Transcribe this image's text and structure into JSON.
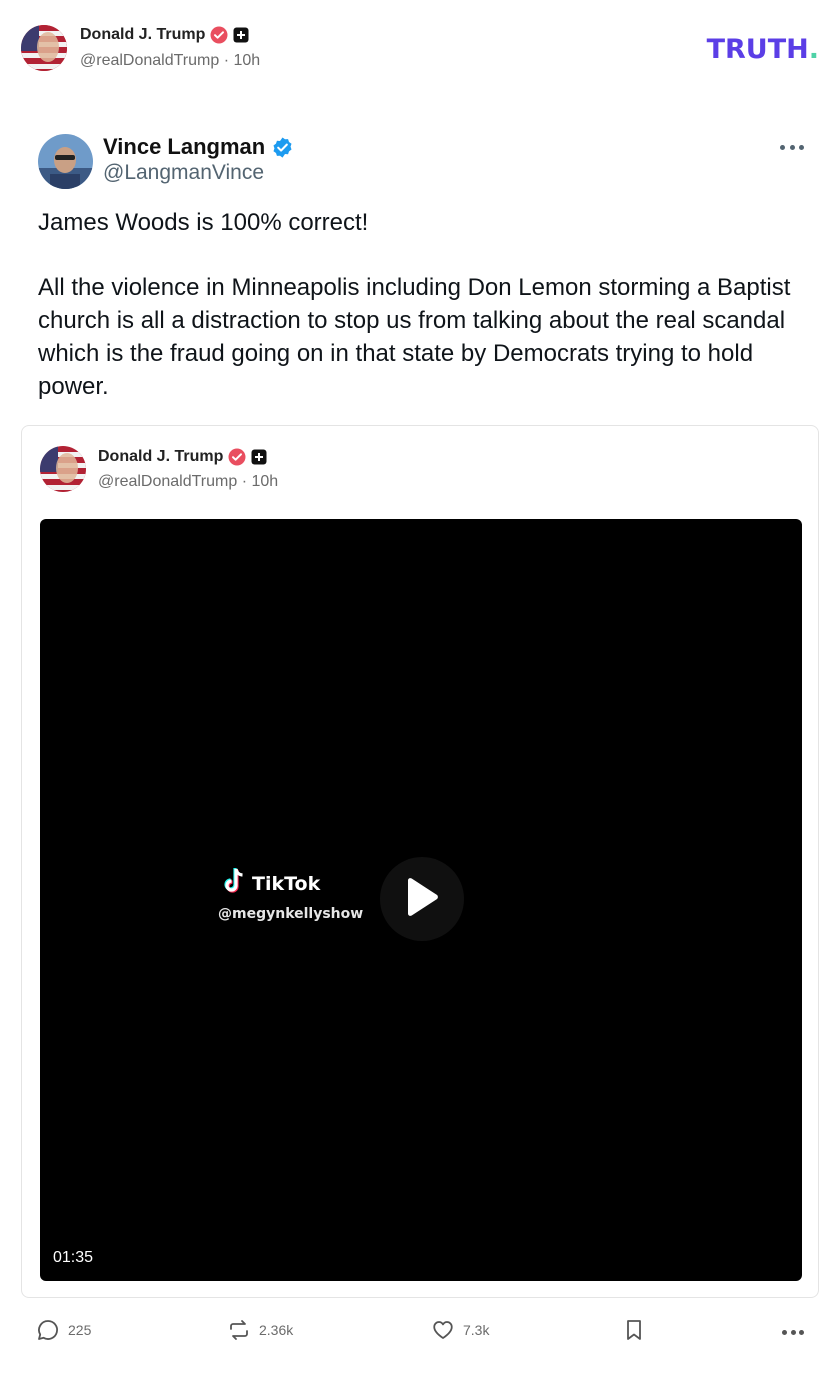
{
  "post": {
    "author_name": "Donald J. Trump",
    "author_handle": "@realDonaldTrump",
    "time": "10h",
    "brand": "TRUTH",
    "brand_dot": "."
  },
  "quoted": {
    "name": "Vince Langman",
    "handle": "@LangmanVince",
    "text_1": "James Woods is 100% correct!",
    "text_2": "All the violence in Minneapolis including Don Lemon storming a Baptist church is all a distraction to stop us from talking about the real scandal which is the fraud going on in that state by Democrats trying to hold power."
  },
  "embedded": {
    "author_name": "Donald J. Trump",
    "author_handle": "@realDonaldTrump",
    "time": "10h",
    "video": {
      "watermark": "TikTok",
      "watermark_user": "@megynkellyshow",
      "duration": "01:35"
    }
  },
  "actions": {
    "replies": "225",
    "retruths": "2.36k",
    "likes": "7.3k"
  },
  "icons": [
    "verified-icon",
    "plus-badge-icon",
    "blue-check-icon",
    "more-icon",
    "play-icon",
    "tiktok-icon",
    "reply-icon",
    "retruth-icon",
    "like-icon",
    "bookmark-icon"
  ],
  "colors": {
    "brand": "#5b3ee6",
    "brand_dot": "#4fd2a7",
    "verified_red": "#e94e5f",
    "blue_check": "#1d9bf0"
  }
}
